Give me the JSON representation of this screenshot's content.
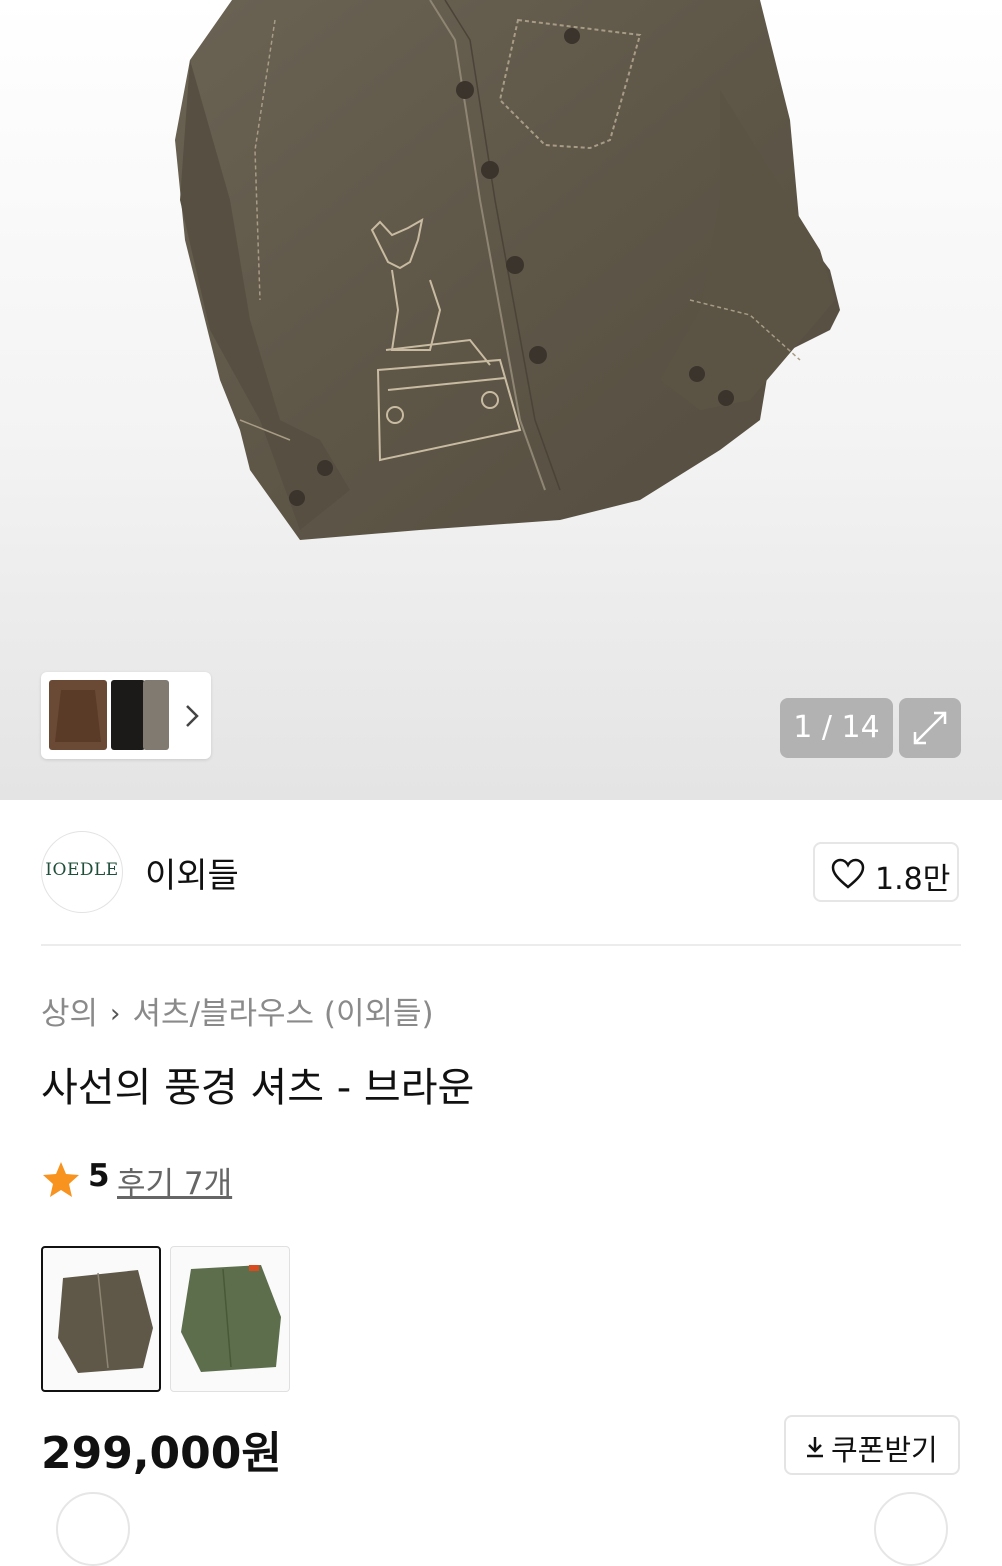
{
  "gallery": {
    "counter": "1 / 14",
    "thumbnail_count_hint": 3
  },
  "brand": {
    "logo_text": "IOEDLE",
    "name": "이외들",
    "likes": "1.8만"
  },
  "breadcrumb": [
    "상의",
    "셔츠/블라우스 (이외들)"
  ],
  "product": {
    "title": "사선의 풍경 셔츠 - 브라운",
    "rating": "5",
    "reviews": "후기 7개",
    "color_options": [
      "brown",
      "green"
    ],
    "price": "299,000원",
    "coupon_label": "쿠폰받기"
  },
  "colors": {
    "shirt_brown": "#5f5748",
    "shirt_green": "#5d6e4d",
    "star": "#f7931e",
    "logo_green": "#1f4f3a"
  }
}
